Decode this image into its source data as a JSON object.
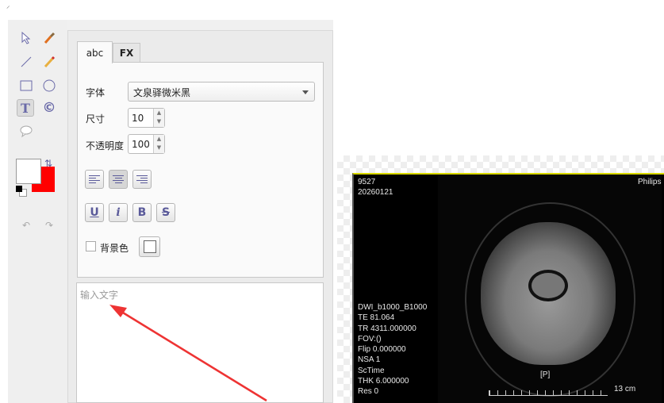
{
  "toolbar": {
    "tools": [
      "select",
      "eyedropper",
      "line",
      "pencil",
      "rectangle",
      "ellipse",
      "text",
      "copyright",
      "speech-bubble"
    ],
    "active": "text",
    "primary_color": "#ffffff",
    "secondary_color": "#ff0000"
  },
  "panel": {
    "tabs": [
      {
        "label": "abc",
        "active": true
      },
      {
        "label": "FX",
        "active": false
      }
    ],
    "font_label": "字体",
    "font_value": "文泉驿微米黑",
    "size_label": "尺寸",
    "size_value": "10",
    "opacity_label": "不透明度",
    "opacity_value": "100",
    "style_buttons": {
      "underline": "U",
      "italic": "i",
      "bold": "B",
      "strike": "S"
    },
    "alignment_active": "center",
    "bg_color_label": "背景色",
    "bg_color_checked": false,
    "text_placeholder": "输入文字"
  },
  "viewer": {
    "top_left": [
      "9527",
      "20260121"
    ],
    "top_right": "Philips",
    "bottom_left": [
      "DWI_b1000_B1000",
      "TE 81.064",
      "TR 4311.000000",
      "FOV:()",
      "Flip 0.000000",
      "NSA 1",
      "ScTime",
      "THK 6.000000",
      "Res 0"
    ],
    "orientation": "[P]",
    "scale": "13 cm"
  },
  "annotation_color": "#ee3333"
}
